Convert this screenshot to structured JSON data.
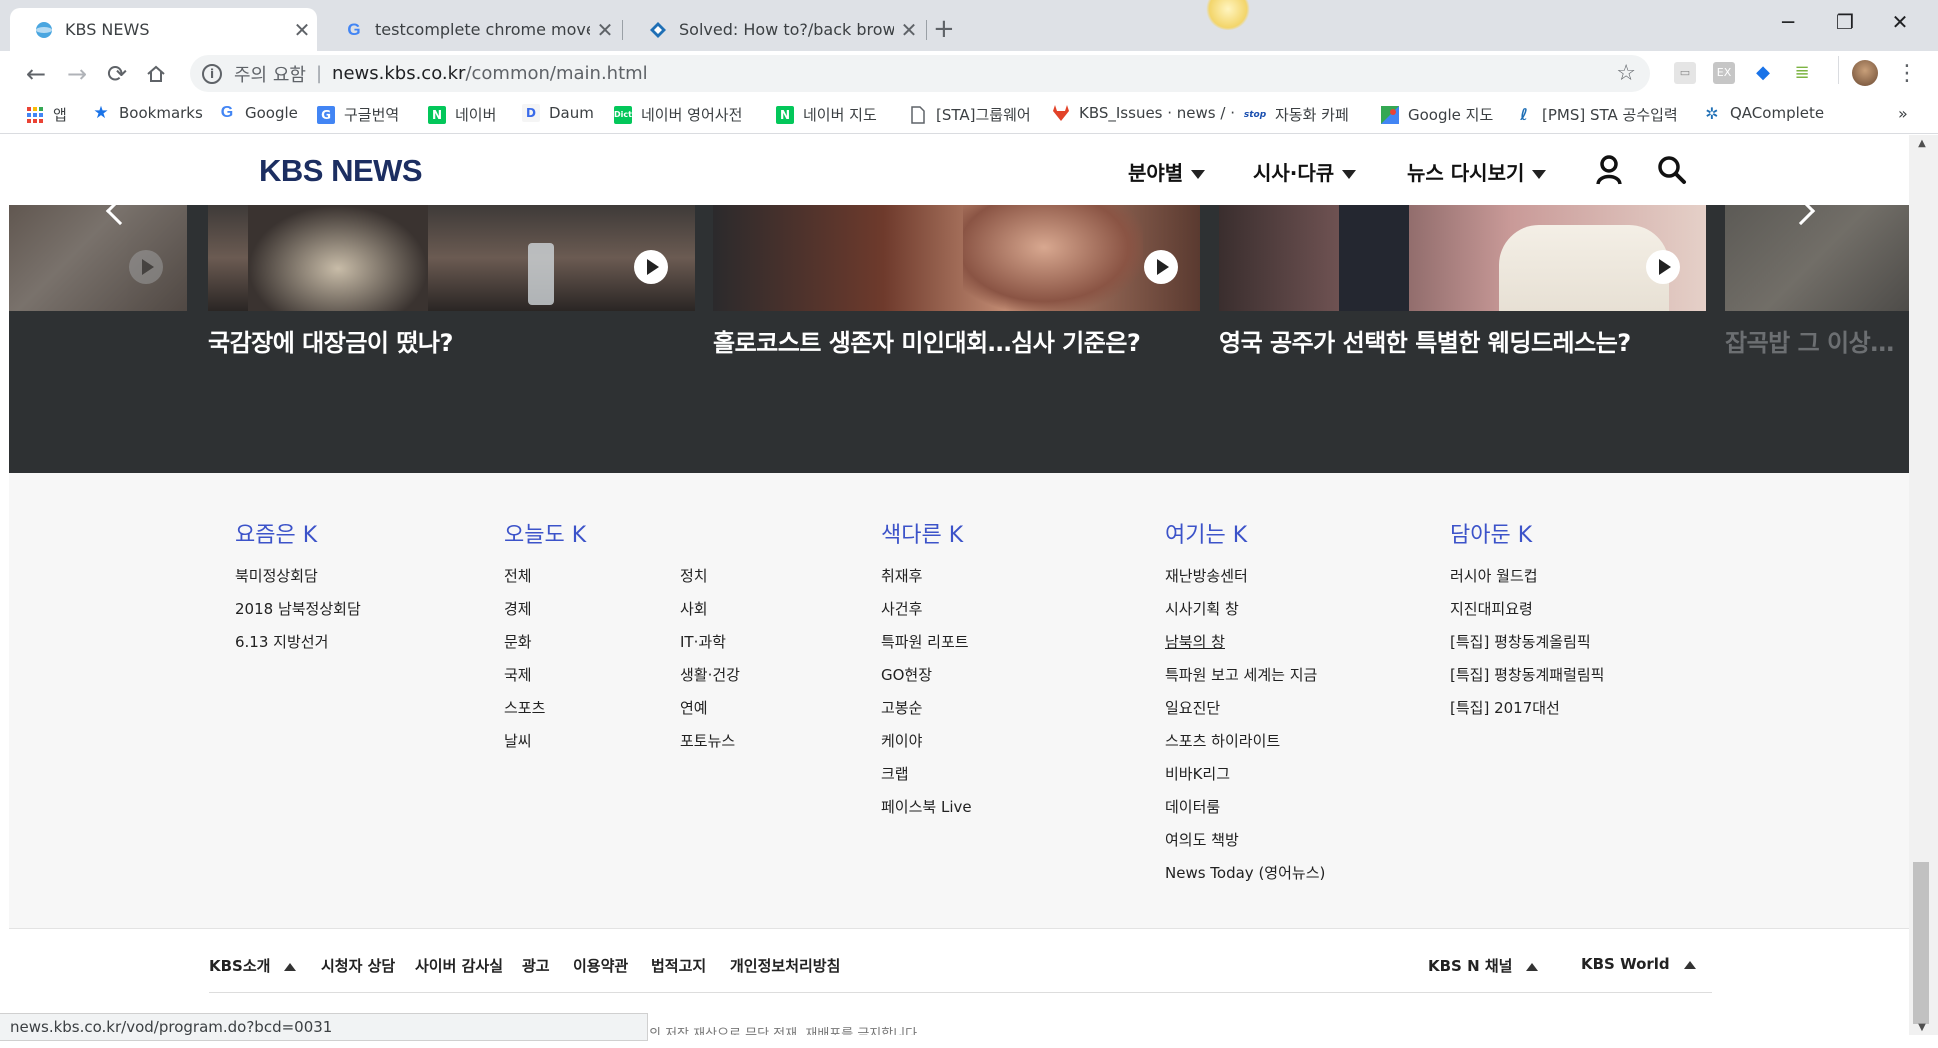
{
  "browser": {
    "tabs": [
      {
        "title": "KBS NEWS",
        "favicon": "kbs-globe-icon",
        "active": true
      },
      {
        "title": "testcomplete chrome move pre",
        "favicon": "google-g-icon",
        "active": false
      },
      {
        "title": "Solved: How to?/back browser",
        "favicon": "smartbear-diamond-icon",
        "active": false
      }
    ],
    "new_tab_symbol": "+",
    "window_controls": {
      "minimize": "─",
      "maximize": "❐",
      "close": "✕"
    },
    "address": {
      "security_label": "주의 요함",
      "domain": "news.kbs.co.kr",
      "path": "/common/main.html"
    },
    "bookmarks": [
      {
        "label": "앱",
        "icon": "apps-grid-icon"
      },
      {
        "label": "Bookmarks",
        "icon": "star-icon"
      },
      {
        "label": "Google",
        "icon": "google-g-icon"
      },
      {
        "label": "구글번역",
        "icon": "translate-icon"
      },
      {
        "label": "네이버",
        "icon": "naver-n-icon"
      },
      {
        "label": "Daum",
        "icon": "daum-icon"
      },
      {
        "label": "네이버 영어사전",
        "icon": "dict-icon"
      },
      {
        "label": "네이버 지도",
        "icon": "naver-n-icon"
      },
      {
        "label": "[STA]그룹웨어",
        "icon": "page-icon"
      },
      {
        "label": "KBS_Issues · news / ·",
        "icon": "gitlab-icon"
      },
      {
        "label": "자동화 카페",
        "icon": "cafe-icon"
      },
      {
        "label": "Google 지도",
        "icon": "maps-icon"
      },
      {
        "label": "[PMS] STA 공수입력",
        "icon": "pms-icon"
      },
      {
        "label": "QAComplete",
        "icon": "qacomplete-icon"
      }
    ],
    "bookmarks_overflow": "»",
    "status_url": "news.kbs.co.kr/vod/program.do?bcd=0031"
  },
  "site": {
    "logo": "KBS NEWS",
    "nav": [
      {
        "label": "분야별"
      },
      {
        "label": "시사·다큐"
      },
      {
        "label": "뉴스 다시보기"
      }
    ],
    "videos": [
      {
        "caption": "",
        "faded": true
      },
      {
        "caption": "국감장에 대장금이 떴나?",
        "faded": false
      },
      {
        "caption": "홀로코스트 생존자 미인대회…심사 기준은?",
        "faded": false
      },
      {
        "caption": "영국 공주가 선택한 특별한 웨딩드레스는?",
        "faded": false
      },
      {
        "caption": "잡곡밥 그 이상…",
        "faded": true
      }
    ],
    "sitemap": {
      "col1": {
        "title": "요즘은 K",
        "items": [
          "북미정상회담",
          "2018 남북정상회담",
          "6.13 지방선거"
        ]
      },
      "col2": {
        "title": "오늘도 K",
        "items_a": [
          "전체",
          "경제",
          "문화",
          "국제",
          "스포츠",
          "날씨"
        ],
        "items_b": [
          "정치",
          "사회",
          "IT·과학",
          "생활·건강",
          "연예",
          "포토뉴스"
        ]
      },
      "col3": {
        "title": "색다른 K",
        "items": [
          "취재후",
          "사건후",
          "특파원 리포트",
          "GO현장",
          "고봉순",
          "케이야",
          "크랩",
          "페이스북 Live"
        ]
      },
      "col4": {
        "title": "여기는 K",
        "items": [
          "재난방송센터",
          "시사기획 창",
          "남북의 창",
          "특파원 보고 세계는 지금",
          "일요진단",
          "스포츠 하이라이트",
          "비바K리그",
          "데이터룸",
          "여의도 책방",
          "News Today (영어뉴스)"
        ]
      },
      "col5": {
        "title": "담아둔 K",
        "items": [
          "러시아 월드컵",
          "지진대피요령",
          "[특집] 평창동계올림픽",
          "[특집] 평창동계패럴림픽",
          "[특집] 2017대선"
        ]
      }
    },
    "footer": {
      "links": [
        "KBS소개",
        "시청자 상담",
        "사이버 감사실",
        "광고",
        "이용약관",
        "법적고지",
        "개인정보처리방침"
      ],
      "right_links": [
        "KBS N 채널",
        "KBS World"
      ],
      "copyright_fragment": "의 저작 재산으로 무단 전재, 재배포를 금지합니다"
    }
  },
  "colors": {
    "kbs_navy": "#1c2e61",
    "sitemap_title_blue": "#3c53c9",
    "video_strip_bg": "#2e3133",
    "footer_bg": "#f7f7f7"
  }
}
